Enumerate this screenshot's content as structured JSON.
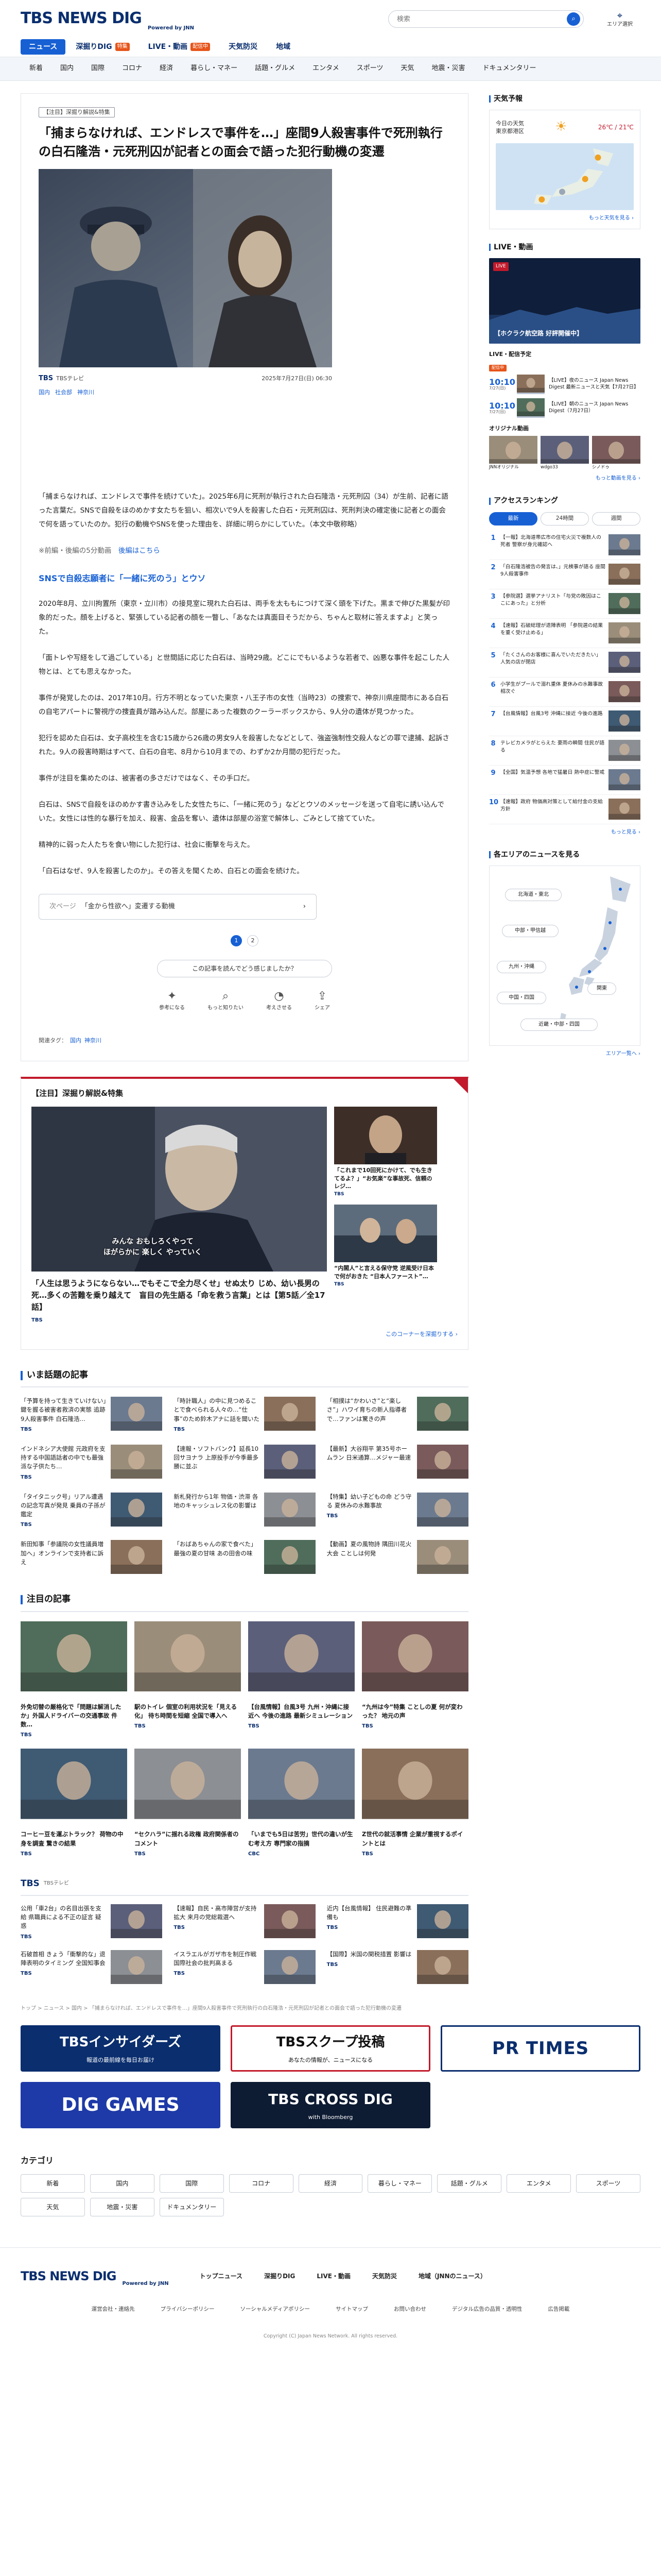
{
  "header": {
    "logo_main": "TBS NEWS DIG",
    "logo_sub": "Powered by JNN",
    "search_placeholder": "検索",
    "area_label": "エリア選択",
    "nav_primary": [
      {
        "label": "ニュース",
        "badge": ""
      },
      {
        "label": "深掘りDIG",
        "badge": "特集"
      },
      {
        "label": "LIVE・動画",
        "badge": "配信中"
      },
      {
        "label": "天気防災",
        "badge": ""
      },
      {
        "label": "地域",
        "badge": ""
      }
    ],
    "nav_secondary": [
      "新着",
      "国内",
      "国際",
      "コロナ",
      "経済",
      "暮らし・マネー",
      "話題・グルメ",
      "エンタメ",
      "スポーツ",
      "天気",
      "地震・災害",
      "ドキュメンタリー"
    ]
  },
  "article": {
    "tag": "【注目】深掘り解説&特集",
    "title": "「捕まらなければ、エンドレスで事件を…」座間9人殺害事件で死刑執行の白石隆浩・元死刑囚が記者との面会で語った犯行動機の変遷",
    "source": "TBSテレビ",
    "date": "2025年7月27日(日) 06:30",
    "tags": [
      "国内",
      "社会部",
      "神奈川"
    ],
    "lead": "「捕まらなければ、エンドレスで事件を続けていた」。2025年6月に死刑が執行された白石隆浩・元死刑囚（34）が生前、記者に語った言葉だ。SNSで自殺をほのめかす女たちを狙い、相次いで9人を殺害した白石・元死刑囚は、死刑判決の確定後に記者との面会で何を語っていたのか。犯行の動機やSNSを使った理由を、詳細に明らかにしていた。（本文中敬称略）",
    "note_prefix": "※前編・後編の5分動画",
    "note_link": "後編はこちら",
    "h2": "SNSで自殺志願者に「一緒に死のう」とウソ",
    "paragraphs": [
      "2020年8月、立川拘置所（東京・立川市）の接見室に現れた白石は、両手を太ももにつけて深く頭を下げた。黒まで伸びた黒髪が印象的だった。顔を上げると、緊張している記者の顔を一瞥し、「あなたは真面目そうだから、ちゃんと取材に答えますよ」と笑った。",
      "「面トレや写経をして過ごしている」と世間話に応じた白石は、当時29歳。どこにでもいるような若者で、凶悪な事件を起こした人物とは、とても思えなかった。",
      "事件が発覚したのは、2017年10月。行方不明となっていた東京・八王子市の女性（当時23）の捜索で、神奈川県座間市にある白石の自宅アパートに警視庁の捜査員が踏み込んだ。部屋にあった複数のクーラーボックスから、9人分の遺体が見つかった。",
      "犯行を認めた白石は、女子高校生を含む15歳から26歳の男女9人を殺害したなどとして、強盗強制性交殺人などの罪で逮捕、起訴された。9人の殺害時期はすべて、白石の自宅、8月から10月までの、わずか2か月間の犯行だった。",
      "事件が注目を集めたのは、被害者の多さだけではなく、その手口だ。",
      "白石は、SNSで自殺をほのめかす書き込みをした女性たちに、「一緒に死のう」などとウソのメッセージを送って自宅に誘い込んでいた。女性には性的な暴行を加え、殺害、金品を奪い、遺体は部屋の浴室で解体し、ごみとして捨てていた。",
      "精神的に弱った人たちを食い物にした犯行は、社会に衝撃を与えた。",
      "「白石はなぜ、9人を殺害したのか」。その答えを聞くため、白石との面会を続けた。"
    ],
    "next_label": "次ページ",
    "next_title": "「金から性欲へ」変遷する動機",
    "pages": [
      "1",
      "2"
    ],
    "share_question": "この記事を読んでどう感じましたか？",
    "reactions": [
      "参考になる",
      "もっと知りたい",
      "考えさせる",
      "シェア"
    ],
    "footer_tags_label": "関連タグ：",
    "footer_tags": [
      "国内",
      "神奈川"
    ]
  },
  "feature": {
    "title": "【注目】深掘り解説&特集",
    "main_caption": "「人生は思うようにならない…でもそこで全力尽くせ」せぬ太り じめ、幼い長男の死…多くの苦難を乗り越えて　盲目の先生語る「命を救う言葉」とは【第5話／全17話】",
    "main_source": "TBS",
    "main_subtitle": "みんな おもしろくやって\nほがらかに 楽しく やっていく",
    "side": [
      {
        "caption": "「これまで10回死にかけて、でも生きてるよ？」“お気楽”な事故死、信頼のレジ…",
        "source": "TBS"
      },
      {
        "caption": "“内閣人”と言える保守党 逆風受け日本で何がおきた “日本人ファースト”…",
        "source": "TBS"
      }
    ],
    "more": "このコーナーを深掘りする"
  },
  "now_topics": {
    "title": "いま話題の記事",
    "items": [
      {
        "text": "「予算を持って生きていけない」鍵を握る被害者救済の実態 追跡9人殺害事件 白石隆浩…",
        "source": "TBS",
        "date": "2025/07/27"
      },
      {
        "text": "「時計職人」の中に見つめることで食べられる人々の…“仕事”のため鈴木アナに話を聞いた",
        "source": "TBS",
        "date": "2025/07/27"
      },
      {
        "text": "「相撲は“かわいさ”と“楽しさ”」ハワイ育ちの新人指導者で…ファンは驚きの声",
        "source": "",
        "date": "2025/07/27"
      },
      {
        "text": "インドネシア大使館 元政府を支持する中国語話者の中でも最強派な子供たち…",
        "source": "TBS",
        "date": "2025/07/27"
      },
      {
        "text": "【速報・ソフトバンク】延長10回サヨナラ 上原投手が今季最多勝に並ぶ",
        "source": "",
        "date": "2025/07/27"
      },
      {
        "text": "【最新】大谷翔平 第35号ホームラン 日米通算…メジャー最速",
        "source": "",
        "date": "2025/07/27"
      },
      {
        "text": "「タイタニック号」リアル遭遇の記念写真が発見 乗員の子孫が鑑定",
        "source": "TBS",
        "date": "2025/07/27"
      },
      {
        "text": "新札発行から1年 物価・渋滞 各地のキャッシュレス化の影響は",
        "source": "",
        "date": "2025/07/27"
      },
      {
        "text": "【特集】幼い子どもの命 どう守る 夏休みの水難事故",
        "source": "TBS",
        "date": "2025/07/27"
      },
      {
        "text": "新田知事「参議院の女性議員増加へ」オンラインで支持者に訴え",
        "source": "",
        "date": "2025/07/27"
      },
      {
        "text": "「おばあちゃんの家で食べた」最強の夏の甘味 あの田舎の味",
        "source": "",
        "date": "2025/07/27"
      },
      {
        "text": "【動画】夏の風物詩 隅田川花火大会 ことしは何発",
        "source": "",
        "date": "2025/07/27"
      }
    ]
  },
  "picks": {
    "title": "注目の記事",
    "items": [
      {
        "text": "外免切替の厳格化で「問題は解消したか」外国人ドライバーの交通事故 件数…",
        "source": "TBS"
      },
      {
        "text": "駅のトイレ 個室の利用状況を「見える化」 待ち時間を短縮 全国で導入へ",
        "source": "TBS"
      },
      {
        "text": "【台風情報】台風3号 九州・沖縄に接近へ 今後の進路 最新シミュレーション",
        "source": "TBS"
      },
      {
        "text": "“九州は今”特集 ことしの夏 何が変わった？ 地元の声",
        "source": "TBS"
      },
      {
        "text": "コーヒー豆を運ぶトラック？ 荷物の中身を調査 驚きの結果",
        "source": "TBS"
      },
      {
        "text": "“セクハラ”に揺れる政権 政府関係者のコメント",
        "source": "TBS"
      },
      {
        "text": "「いまでも5日は苦労」世代の違いが生む考え方 専門家の指摘",
        "source": "CBC"
      },
      {
        "text": "Z世代の就活事情 企業が重視するポイントとは",
        "source": "TBS"
      }
    ]
  },
  "tbs_section": {
    "title": "TBS",
    "subtitle": "TBSテレビ",
    "items": [
      {
        "text": "公用「車2台」の名目出張を支給 県職員による不正の証言 疑惑",
        "source": "TBS"
      },
      {
        "text": "【速報】自民・高市陣営が支持拡大 来月の党総裁選へ",
        "source": "TBS"
      },
      {
        "text": "近内【台風情報】 住民避難の準備も",
        "source": "TBS"
      },
      {
        "text": "石破首相 きょう「衝撃的な」退陣表明のタイミング 全国知事会",
        "source": "TBS"
      },
      {
        "text": "イスラエルがガザ市を制圧作戦 国際社会の批判高まる",
        "source": "TBS"
      },
      {
        "text": "【国際】米国の関税措置 影響は",
        "source": "TBS"
      }
    ]
  },
  "breadcrumb": "トップ > ニュース > 国内 > 「捕まらなければ、エンドレスで事件を…」座間9人殺害事件で死刑執行の白石隆浩・元死刑囚が記者との面会で語った犯行動機の変遷",
  "banners": [
    {
      "title": "TBSインサイダーズ",
      "sub": "報道の最前線を毎日お届け"
    },
    {
      "title": "TBSスクープ投稿",
      "sub": "あなたの情報が、ニュースになる"
    },
    {
      "title": "PR TIMES",
      "sub": ""
    },
    {
      "title": "DIG GAMES",
      "sub": ""
    },
    {
      "title": "TBS CROSS DIG",
      "sub": "with Bloomberg"
    }
  ],
  "categories": {
    "title": "カテゴリ",
    "items": [
      "新着",
      "国内",
      "国際",
      "コロナ",
      "経済",
      "暮らし・マネー",
      "話題・グルメ",
      "エンタメ",
      "スポーツ",
      "天気",
      "地震・災害",
      "ドキュメンタリー"
    ]
  },
  "footer": {
    "links": [
      "トップニュース",
      "深掘りDIG",
      "LIVE・動画",
      "天気防災",
      "地域（JNNのニュース）"
    ],
    "sub": [
      "運営会社・連絡先",
      "プライバシーポリシー",
      "ソーシャルメディアポリシー",
      "サイトマップ",
      "お問い合わせ",
      "デジタル広告の品質・透明性",
      "広告掲載"
    ],
    "copy": "Copyright (C) Japan News Network. All rights reserved."
  },
  "sidebar": {
    "weather": {
      "title": "天気予報",
      "location": "今日の天気\n東京都港区",
      "temp": "26℃ / 21℃",
      "more": "もっと天気を見る"
    },
    "live": {
      "title": "LIVE・動画",
      "badge": "LIVE",
      "caption": "【ホクラク航空路 好評開催中】",
      "sched_title": "LIVE・配信予定",
      "onair": "配信中",
      "schedule": [
        {
          "time": "10:10",
          "sub": "7/27(日)",
          "text": "【LIVE】夜のニュース Japan News Digest 最新ニュースと天気【7月27日】"
        },
        {
          "time": "10:10",
          "sub": "7/27(日)",
          "text": "【LIVE】朝のニュース Japan News Digest（7月27日）"
        }
      ],
      "orig_title": "オリジナル動画",
      "originals": [
        "JNNオリジナル",
        "wdgo33",
        "シノドゥ"
      ],
      "more": "もっと動画を見る"
    },
    "ranking": {
      "title": "アクセスランキング",
      "tabs": [
        "最新",
        "24時間",
        "週間"
      ],
      "items": [
        {
          "n": "1",
          "text": "【一報】北海道帯広市の住宅火災で複数人の死者 警察が身元確認へ"
        },
        {
          "n": "2",
          "text": "「白石隆浩被告の発言は、」元検事が語る 座間9人殺害事件"
        },
        {
          "n": "3",
          "text": "【参院選】選挙アナリスト「与党の敗因はここにあった」と分析"
        },
        {
          "n": "4",
          "text": "【速報】石破総理が退陣表明 「参院選の結果を重く受け止める」"
        },
        {
          "n": "5",
          "text": "「たくさんのお客様に喜んでいただきたい」人気の店が閉店"
        },
        {
          "n": "6",
          "text": "小学生がプールで溺れ重体 夏休みの水難事故相次ぐ"
        },
        {
          "n": "7",
          "text": "【台風情報】台風3号 沖縄に接近 今後の進路"
        },
        {
          "n": "8",
          "text": "テレビカメラがとらえた 豪雨の瞬間 住民が語る"
        },
        {
          "n": "9",
          "text": "【全国】気温予想 各地で猛暑日 熱中症に警戒"
        },
        {
          "n": "10",
          "text": "【速報】政府 物価高対策として給付金の支給方針"
        }
      ],
      "more": "もっと見る"
    },
    "area": {
      "title": "各エリアのニュースを見る",
      "buttons": [
        "北海道・東北",
        "中部・甲信越",
        "九州・沖縄",
        "関東",
        "中国・四国",
        "近畿・中部・四国"
      ],
      "more": "エリア一覧へ"
    }
  }
}
